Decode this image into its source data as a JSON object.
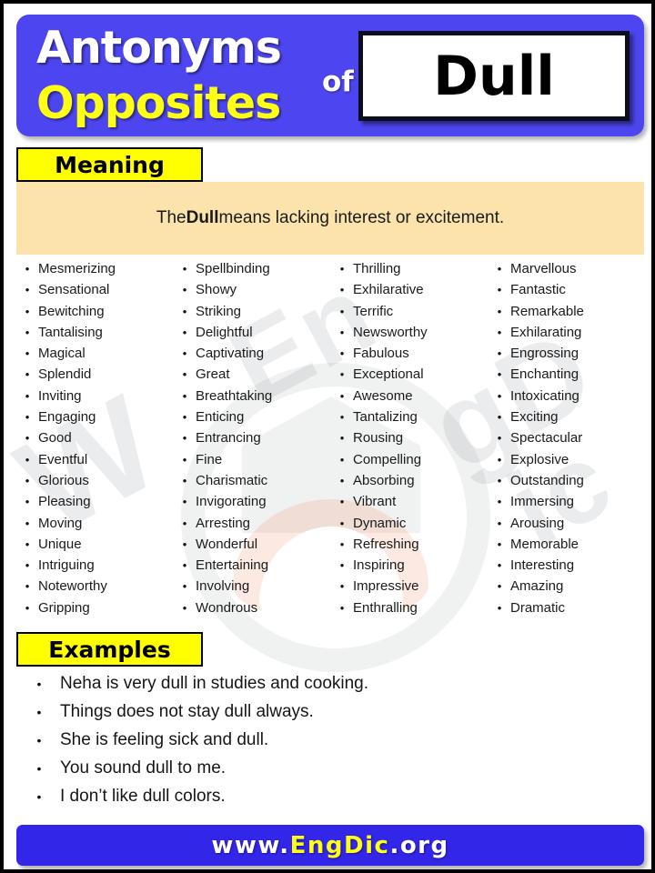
{
  "header": {
    "title_line1": "Antonyms",
    "title_line2": "Opposites",
    "connector": "of",
    "word": "Dull",
    "band_color": "#4d46f0",
    "line1_color": "#ffffff",
    "line2_color": "#ffff14"
  },
  "meaning": {
    "label": "Meaning",
    "prefix": "The ",
    "word": "Dull",
    "suffix": " means lacking interest or excitement.",
    "full_text": "The Dull means lacking interest or excitement.",
    "band_color": "#fbe3ab",
    "label_color": "#ffff00"
  },
  "words": {
    "columns": [
      {
        "items": [
          "Mesmerizing",
          "Sensational",
          "Bewitching",
          "Tantalising",
          "Magical",
          "Splendid",
          "Inviting",
          "Engaging",
          "Good",
          "Eventful",
          "Glorious",
          "Pleasing",
          "Moving",
          "Unique",
          "Intriguing",
          "Noteworthy",
          "Gripping"
        ]
      },
      {
        "items": [
          "Spellbinding",
          "Showy",
          "Striking",
          "Delightful",
          "Captivating",
          "Great",
          "Breathtaking",
          "Enticing",
          "Entrancing",
          "Fine",
          "Charismatic",
          "Invigorating",
          "Arresting",
          "Wonderful",
          "Entertaining",
          "Involving",
          "Wondrous"
        ]
      },
      {
        "items": [
          "Thrilling",
          "Exhilarative",
          "Terrific",
          "Newsworthy",
          "Fabulous",
          "Exceptional",
          "Awesome",
          "Tantalizing",
          "Rousing",
          "Compelling",
          "Absorbing",
          "Vibrant",
          "Dynamic",
          "Refreshing",
          "Inspiring",
          "Impressive",
          "Enthralling"
        ]
      },
      {
        "items": [
          "Marvellous",
          "Fantastic",
          "Remarkable",
          "Exhilarating",
          "Engrossing",
          "Enchanting",
          "Intoxicating",
          "Exciting",
          "Spectacular",
          "Explosive",
          "Outstanding",
          "Immersing",
          "Arousing",
          "Memorable",
          "Interesting",
          "Amazing",
          "Dramatic"
        ]
      }
    ],
    "bullet": "•"
  },
  "examples": {
    "label": "Examples",
    "label_color": "#ffff00",
    "bullet": "•",
    "items": [
      "Neha is very dull in studies and cooking.",
      "Things does not stay dull always.",
      "She is feeling sick and dull.",
      "You sound dull to me.",
      "I don’t like dull colors."
    ]
  },
  "footer": {
    "prefix": "www.",
    "brand_eng": "Eng",
    "brand_dic": "Dic",
    "suffix": ".org",
    "full_text": "www.EngDic.org",
    "band_color": "#3226e8",
    "brand_color": "#ffff14"
  },
  "watermark": {
    "text": "www.EngDic.org"
  }
}
